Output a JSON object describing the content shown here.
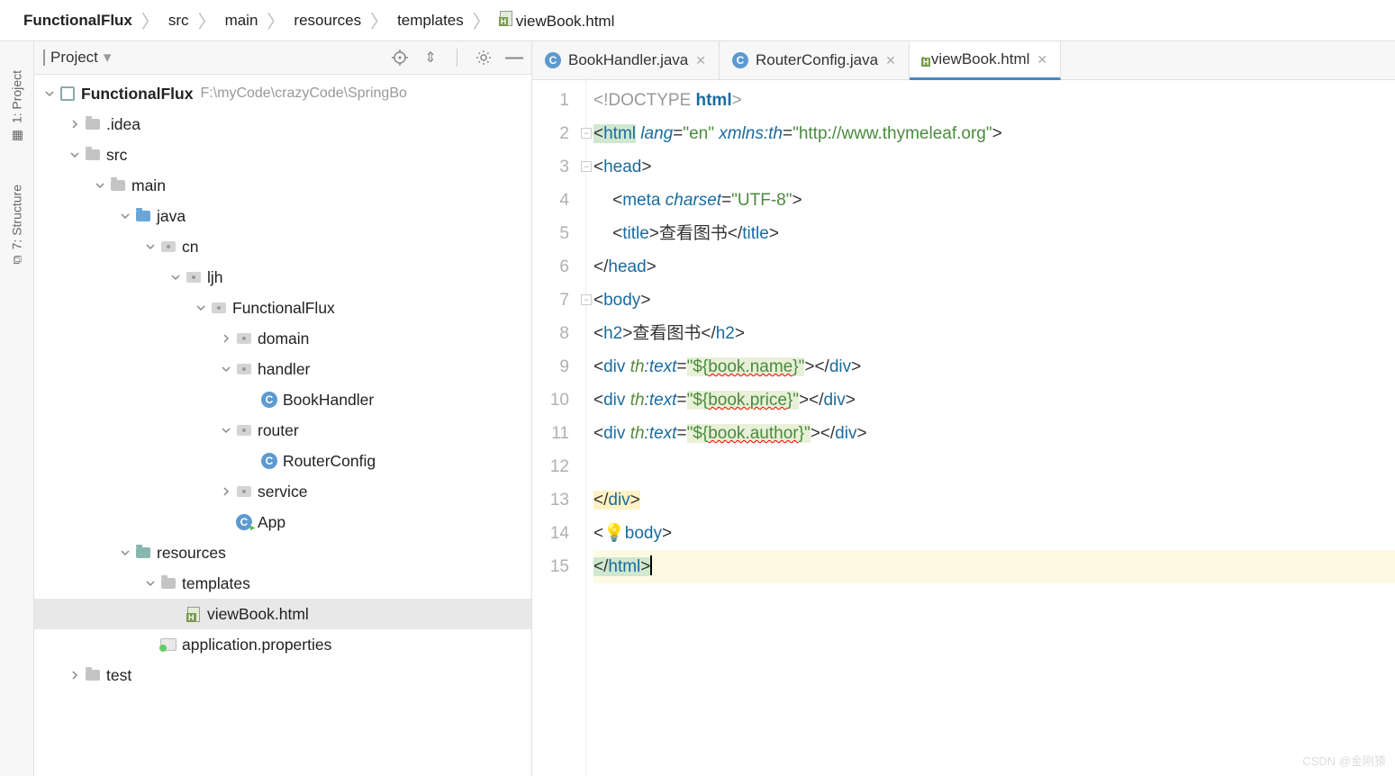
{
  "breadcrumb": [
    "FunctionalFlux",
    "src",
    "main",
    "resources",
    "templates",
    "viewBook.html"
  ],
  "project_panel": {
    "title": "Project",
    "tree": [
      {
        "indent": 0,
        "arrow": "down",
        "icon": "module",
        "label": "FunctionalFlux",
        "aux": "F:\\myCode\\crazyCode\\SpringBo",
        "root": true
      },
      {
        "indent": 1,
        "arrow": "right",
        "icon": "folder-gray",
        "label": ".idea"
      },
      {
        "indent": 1,
        "arrow": "down",
        "icon": "folder-gray",
        "label": "src"
      },
      {
        "indent": 2,
        "arrow": "down",
        "icon": "folder-gray",
        "label": "main"
      },
      {
        "indent": 3,
        "arrow": "down",
        "icon": "folder-blue",
        "label": "java"
      },
      {
        "indent": 4,
        "arrow": "down",
        "icon": "pkg",
        "label": "cn"
      },
      {
        "indent": 5,
        "arrow": "down",
        "icon": "pkg",
        "label": "ljh"
      },
      {
        "indent": 6,
        "arrow": "down",
        "icon": "pkg",
        "label": "FunctionalFlux"
      },
      {
        "indent": 7,
        "arrow": "right",
        "icon": "pkg",
        "label": "domain"
      },
      {
        "indent": 7,
        "arrow": "down",
        "icon": "pkg",
        "label": "handler"
      },
      {
        "indent": 8,
        "arrow": "",
        "icon": "class",
        "label": "BookHandler"
      },
      {
        "indent": 7,
        "arrow": "down",
        "icon": "pkg",
        "label": "router"
      },
      {
        "indent": 8,
        "arrow": "",
        "icon": "class",
        "label": "RouterConfig"
      },
      {
        "indent": 7,
        "arrow": "right",
        "icon": "pkg",
        "label": "service"
      },
      {
        "indent": 7,
        "arrow": "",
        "icon": "class-run",
        "label": "App"
      },
      {
        "indent": 3,
        "arrow": "down",
        "icon": "folder-teal",
        "label": "resources"
      },
      {
        "indent": 4,
        "arrow": "down",
        "icon": "folder-gray",
        "label": "templates"
      },
      {
        "indent": 5,
        "arrow": "",
        "icon": "html",
        "label": "viewBook.html",
        "selected": true
      },
      {
        "indent": 4,
        "arrow": "",
        "icon": "props",
        "label": "application.properties"
      },
      {
        "indent": 1,
        "arrow": "right",
        "icon": "folder-gray",
        "label": "test"
      }
    ]
  },
  "sidebar": {
    "project": "1: Project",
    "structure": "7: Structure"
  },
  "tabs": [
    {
      "icon": "class",
      "label": "BookHandler.java",
      "active": false
    },
    {
      "icon": "class",
      "label": "RouterConfig.java",
      "active": false
    },
    {
      "icon": "html",
      "label": "viewBook.html",
      "active": true
    }
  ],
  "code": {
    "lines": [
      {
        "n": 1,
        "html": "<span class='tk-doctype'>&lt;!DOCTYPE </span><span class='tk-kw'>html</span><span class='tk-doctype'>&gt;</span>"
      },
      {
        "n": 2,
        "fold": true,
        "html": "<span class='hl-htmltag'>&lt;<span class='tk-tag'>html</span></span> <span class='tk-attr'>lang</span>=<span class='tk-str'>\"en\"</span> <span class='tk-attr'>xmlns:th</span>=<span class='tk-str'>\"http://www.thymeleaf.org\"</span>&gt;"
      },
      {
        "n": 3,
        "fold": true,
        "html": "&lt;<span class='tk-tag'>head</span>&gt;"
      },
      {
        "n": 4,
        "html": "    &lt;<span class='tk-tag'>meta</span> <span class='tk-attr'>charset</span>=<span class='tk-str'>\"UTF-8\"</span>&gt;"
      },
      {
        "n": 5,
        "html": "    &lt;<span class='tk-tag'>title</span>&gt;查看图书&lt;/<span class='tk-tag'>title</span>&gt;"
      },
      {
        "n": 6,
        "html": "&lt;/<span class='tk-tag'>head</span>&gt;"
      },
      {
        "n": 7,
        "fold": true,
        "html": "&lt;<span class='tk-tag'>body</span>&gt;"
      },
      {
        "n": 8,
        "html": "&lt;<span class='tk-tag'>h2</span>&gt;查看图书&lt;/<span class='tk-tag'>h2</span>&gt;"
      },
      {
        "n": 9,
        "html": "&lt;<span class='tk-tag'>div</span> <span class='tk-ns'>th</span><span class='tk-attr'>:text</span>=<span class='tk-str hl-tag'>\"${<span class='err'>book.name</span>}\"</span>&gt;&lt;/<span class='tk-tag'>div</span>&gt;"
      },
      {
        "n": 10,
        "html": "&lt;<span class='tk-tag'>div</span> <span class='tk-ns'>th</span><span class='tk-attr'>:text</span>=<span class='tk-str hl-tag'>\"${<span class='err'>book.price</span>}\"</span>&gt;&lt;/<span class='tk-tag'>div</span>&gt;"
      },
      {
        "n": 11,
        "html": "&lt;<span class='tk-tag'>div</span> <span class='tk-ns'>th</span><span class='tk-attr'>:text</span>=<span class='tk-str hl-tag'>\"${<span class='err'>book.author</span>}\"</span>&gt;&lt;/<span class='tk-tag'>div</span>&gt;"
      },
      {
        "n": 12,
        "html": " "
      },
      {
        "n": 13,
        "html": "<span class='hl-open'>&lt;/<span class='tk-tag'>div</span>&gt;</span>"
      },
      {
        "n": 14,
        "html": "&lt;<span class='bulb'>💡</span><span class='tk-tag'>body</span>&gt;"
      },
      {
        "n": 15,
        "current": true,
        "html": "<span class='hl-htmltag'>&lt;/<span class='tk-tag'>html</span>&gt;</span><span class='caret'></span>"
      }
    ]
  },
  "watermark": "CSDN @金刚猿"
}
